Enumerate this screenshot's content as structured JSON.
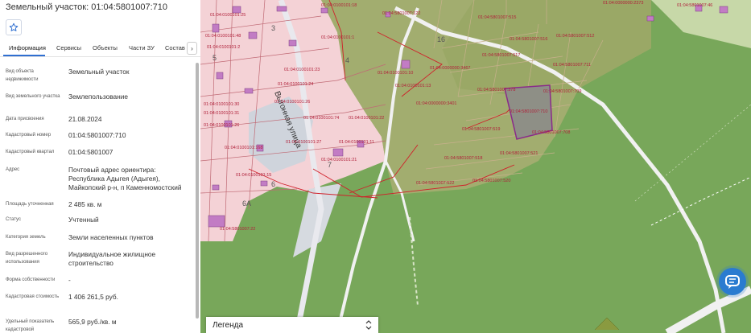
{
  "panel": {
    "title": "Земельный участок: 01:04:5801007:710",
    "tabs": [
      "Информация",
      "Сервисы",
      "Объекты",
      "Части ЗУ",
      "Состав"
    ],
    "fields": [
      {
        "label": "Вид объекта недвижимости",
        "value": "Земельный участок"
      },
      {
        "label": "Вид земельного участка",
        "value": "Землепользование"
      },
      {
        "label": "Дата присвоения",
        "value": "21.08.2024"
      },
      {
        "label": "Кадастровый номер",
        "value": "01:04:5801007:710"
      },
      {
        "label": "Кадастровый квартал",
        "value": "01:04:5801007"
      },
      {
        "label": "Адрес",
        "value": "Почтовый адрес ориентира: Республика Адыгея (Адыгея), Майкопский р-н, п Каменномостский"
      },
      {
        "label": "Площадь уточненная",
        "value": "2 485 кв. м"
      },
      {
        "label": "Статус",
        "value": "Учтенный"
      },
      {
        "label": "Категория земель",
        "value": "Земли населенных пунктов"
      },
      {
        "label": "Вид разрешенного использования",
        "value": "Индивидуальное жилищное строительство"
      },
      {
        "label": "Форма собственности",
        "value": "-"
      },
      {
        "label": "Кадастровая стоимость",
        "value": "1 406 261,5 руб."
      },
      {
        "label": "Удельный показатель кадастровой",
        "value": "565,9 руб./кв. м"
      }
    ]
  },
  "map": {
    "street_label": "Выгонная улица",
    "block_numbers": [
      "5",
      "3",
      "16",
      "4",
      "6",
      "6А",
      "7"
    ],
    "parcel_labels": [
      "01:04:5801007:710",
      "01:04:5801007:709",
      "01:04:5801007:708",
      "01:04:5801007:519",
      "01:04:5801007:521",
      "01:04:5801007:518",
      "01:04:5801007:522",
      "01:04:5801007:520",
      "01:04:5801007:517",
      "01:04:5801007:516",
      "01:04:5801007:515",
      "01:04:5801007:512",
      "01:04:5801007:711",
      "01:04:5801007:378",
      "01:04:0000000:3467",
      "01:04:0000000:3401",
      "01:04:0100101:13",
      "01:04:0100101:10",
      "01:04:0100101:23",
      "01:04:0100101:24",
      "01:04:0100101:26",
      "01:04:0100101:30",
      "01:04:0100101:26",
      "01:04:0100101:168",
      "01:04:0100101:15",
      "01:04:0100101:22",
      "01:04:0100101:21",
      "01:04:0100101:74",
      "01:04:0100101:11",
      "01:04:0100101:48",
      "01:04:0100101:31",
      "01:04:5801007:22",
      "01:04:0100101:25",
      "01:04:0100101:27",
      "01:04:0000000:2373",
      "01:04:5801007:46",
      "01:04:5801007:122",
      "01:04:0100101:2",
      "01:04:0100101:1",
      "01:04:0100101:18"
    ]
  },
  "legend": {
    "label": "Легенда"
  },
  "icons": {
    "star": "star-icon",
    "next": "chevron-right-icon",
    "legend": "chevron-updown-icon",
    "chat": "chat-icon"
  },
  "colors": {
    "accent": "#2f6fd1",
    "forest": "#78a75a",
    "parcel_fill": "#a2ad6f",
    "boundary": "#d0202a",
    "selected": "#8a2a8a",
    "urban": "#f4d2d6"
  }
}
